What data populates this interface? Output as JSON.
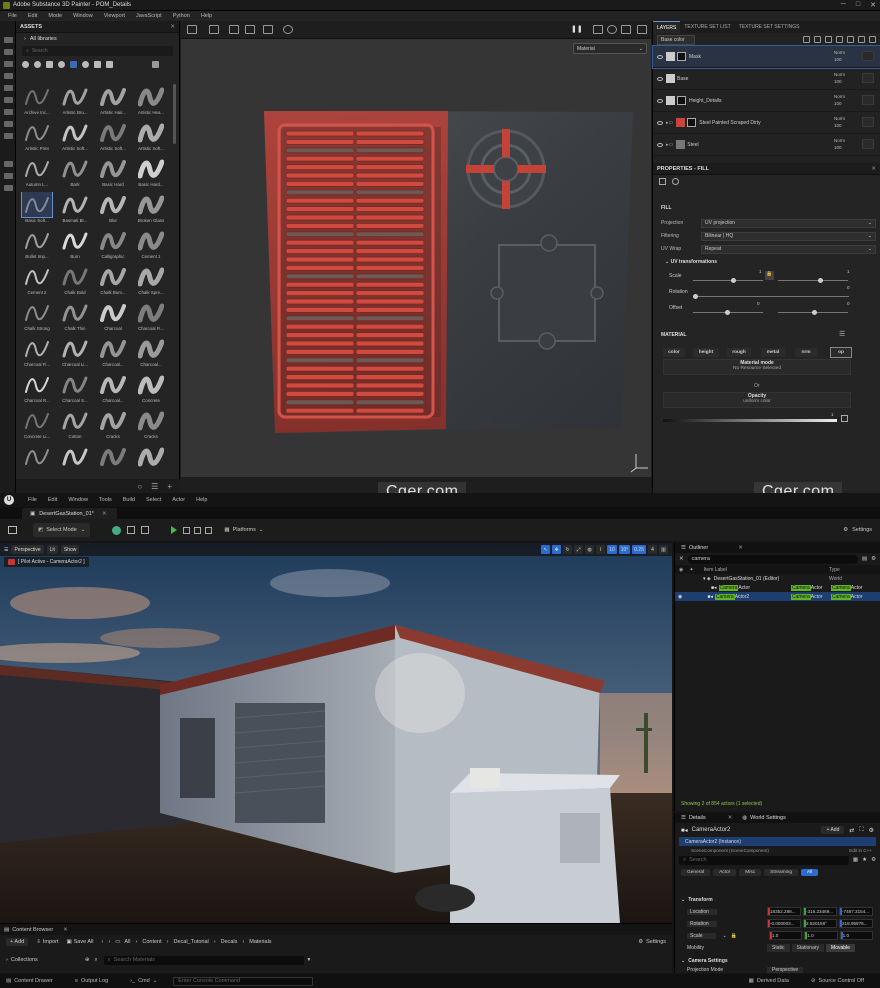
{
  "sp": {
    "title": "Adobe Substance 3D Painter - POM_Details",
    "menu": [
      "File",
      "Edit",
      "Mode",
      "Window",
      "Viewport",
      "JavaScript",
      "Python",
      "Help"
    ],
    "assets": {
      "panel_title": "ASSETS",
      "libraries": "All libraries",
      "search_placeholder": "Search",
      "items": [
        "Archive Inc...",
        "Artistic Bru...",
        "Artistic Hair...",
        "Artistic Hea...",
        "Artistic Print",
        "Artistic Soft...",
        "Artistic Soft...",
        "Artistic Soft...",
        "Autumn L...",
        "Bark",
        "Basic Hard",
        "Basic Hard...",
        "Basic Soft...",
        "Basmati Br...",
        "Blur",
        "Broken Glass",
        "Bullet Imp...",
        "Burn",
        "Calligraphic",
        "Cement 1",
        "Cement 2",
        "Chalk Bold",
        "Chalk Bum...",
        "Chalk Spre...",
        "Chalk Strong",
        "Chalk Thin",
        "Charcoal",
        "Charcoal Fi...",
        "Charcoal Fi...",
        "Charcoal Li...",
        "Charcoal...",
        "Charcoal...",
        "Charcoal R...",
        "Charcoal S...",
        "Charcoal...",
        "Concrete",
        "Concrete Li...",
        "Cotton",
        "Cracks",
        "Cracks",
        "",
        "",
        "",
        ""
      ]
    },
    "viewport": {
      "material_select": "Material"
    },
    "layers": {
      "tabs": [
        "LAYERS",
        "TEXTURE SET LIST",
        "TEXTURE SET SETTINGS"
      ],
      "blend_select": "Base color",
      "rows": [
        {
          "name": "Mask",
          "blend": "Norm",
          "opacity": "100"
        },
        {
          "name": "Base",
          "blend": "Norm",
          "opacity": "100"
        },
        {
          "name": "Height_Details",
          "blend": "Norm",
          "opacity": "100"
        },
        {
          "name": "Steel Painted Scraped Dirty",
          "blend": "Norm",
          "opacity": "100"
        },
        {
          "name": "Steel",
          "blend": "Norm",
          "opacity": "100"
        }
      ]
    },
    "props": {
      "title": "PROPERTIES - FILL",
      "fill_label": "FILL",
      "projection_label": "Projection",
      "projection_value": "UV projection",
      "filtering_label": "Filtering",
      "filtering_value": "Bilinear | HQ",
      "uvwrap_label": "UV Wrap",
      "uvwrap_value": "Repeat",
      "uvt_label": "UV transformations",
      "scale_label": "Scale",
      "scale_value": "1",
      "scale_value2": "1",
      "rotation_label": "Rotation",
      "rotation_value": "0",
      "offset_label": "Offset",
      "offset_value": "0",
      "offset_value2": "0",
      "material_label": "MATERIAL",
      "channels": [
        "color",
        "height",
        "rough",
        "metal",
        "nrm",
        "op"
      ],
      "matmode_title": "Material mode",
      "matmode_sub": "No Resource Selected",
      "or": "Or",
      "opacity_title": "Opacity",
      "opacity_sub": "uniform color",
      "opacity_value": "1"
    }
  },
  "watermarks": [
    "Cger.com",
    "Cger.com"
  ],
  "ue": {
    "menu": [
      "File",
      "Edit",
      "Window",
      "Tools",
      "Build",
      "Select",
      "Actor",
      "Help"
    ],
    "level_tab": "DesertGasStation_01*",
    "select_mode": "Select Mode",
    "platforms": "Platforms",
    "settings": "Settings",
    "viewport": {
      "perspective": "Perspective",
      "lit": "Lit",
      "show": "Show",
      "pilot": "[ Pilot Active - CameraActor2 ]",
      "grid": "10",
      "angle": "10°",
      "scale": "0.25",
      "cams": "4"
    },
    "outliner": {
      "tab": "Outliner",
      "search": "camera",
      "col_label": "Item Label",
      "col_type": "Type",
      "rows": [
        {
          "label": "DesertGasStation_01 (Editor)",
          "type": "World"
        },
        {
          "label_hl": "Camera",
          "label_rest": "Actor",
          "type_hl": "Camera",
          "type_rest": "Actor",
          "type2_hl": "Camera",
          "type2_rest": "Actor"
        },
        {
          "label_hl": "Camera",
          "label_rest": "Actor2",
          "type_hl": "Camera",
          "type_rest": "Actor",
          "type2_hl": "Camera",
          "type2_rest": "Actor"
        }
      ],
      "status": "Showing 2 of 854 actors (1 selected)"
    },
    "details": {
      "tab1": "Details",
      "tab2": "World Settings",
      "name": "CameraActor2",
      "add": "+ Add",
      "instance": "CameraActor2 (Instance)",
      "scene_comp": "SceneComponent (SceneComponent)",
      "edit_in": "Edit in C++",
      "search": "Search",
      "filters": [
        "General",
        "Actor",
        "Misc",
        "Streaming",
        "All"
      ],
      "transform": "Transform",
      "location_label": "Location",
      "location": [
        "18352.288...",
        "-316.23469...",
        "-7487.3154..."
      ],
      "rotation_label": "Rotation",
      "rotation": [
        "-0.000003...",
        "2.520159°",
        "218.95976..."
      ],
      "scale_label": "Scale",
      "scale": [
        "1.0",
        "1.0",
        "1.0"
      ],
      "mobility_label": "Mobility",
      "mobility": [
        "Static",
        "Stationary",
        "Movable"
      ],
      "camera_settings": "Camera Settings",
      "projection_mode": "Projection Mode",
      "perspective": "Perspective"
    },
    "content_browser": {
      "tab": "Content Browser",
      "add": "+ Add",
      "import": "Import",
      "save_all": "Save All",
      "path": [
        "All",
        "Content",
        "Decal_Tutorial",
        "Decals",
        "Materials"
      ],
      "settings": "Settings",
      "collections": "Collections",
      "search_placeholder": "Search Materials"
    },
    "status": {
      "drawer": "Content Drawer",
      "output": "Output Log",
      "cmd": "Cmd",
      "console_placeholder": "Enter Console Command",
      "derived": "Derived Data",
      "source": "Source Control Off"
    }
  }
}
